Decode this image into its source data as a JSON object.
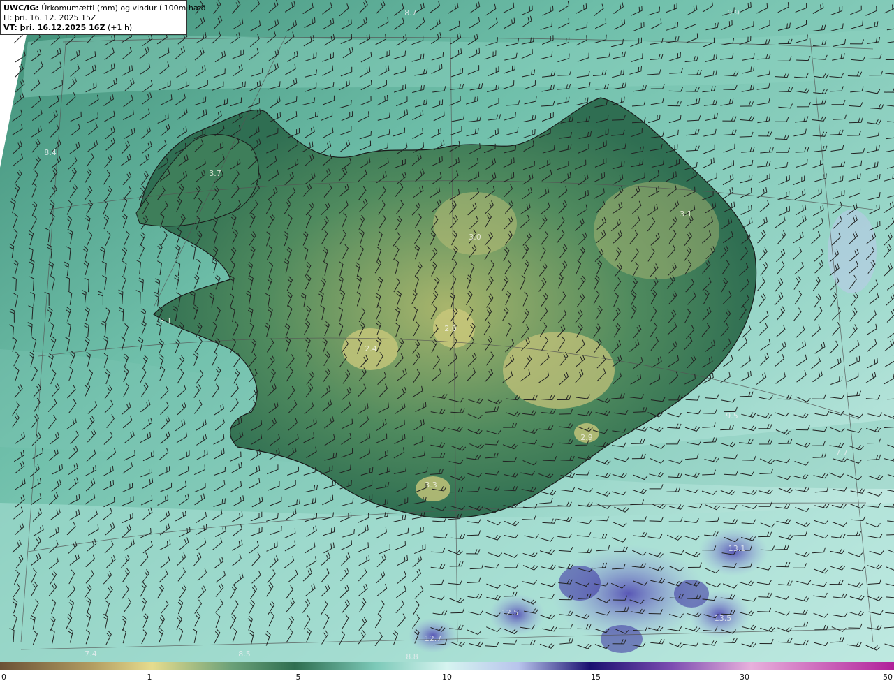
{
  "header": {
    "model_label": "UWC/IG:",
    "description": "Úrkomumætti (mm) og vindur í 100m hæð",
    "issue_time": "IT: þri. 16. 12. 2025 15Z",
    "valid_label": "VT: þri. 16.12.2025 16Z",
    "valid_offset": "(+1 h)"
  },
  "colorbar": {
    "ticks": [
      "0",
      "1",
      "5",
      "10",
      "15",
      "30",
      "50"
    ],
    "stops": [
      "#7a5a3a",
      "#c9b46a",
      "#e8e08c",
      "#2e6e50",
      "#8fd4c4",
      "#d6f4f0",
      "#2a1a7a",
      "#7b4bb0",
      "#e8a8d8",
      "#b0209a"
    ]
  },
  "map_values": [
    {
      "text": "3.7",
      "kind": "land"
    },
    {
      "text": "3.0",
      "kind": "land"
    },
    {
      "text": "3.1",
      "kind": "land"
    },
    {
      "text": "3.1",
      "kind": "land"
    },
    {
      "text": "2.4",
      "kind": "land"
    },
    {
      "text": "2.0",
      "kind": "land"
    },
    {
      "text": "2.9",
      "kind": "land"
    },
    {
      "text": "3.3",
      "kind": "land"
    },
    {
      "text": "8.4",
      "kind": "sea"
    },
    {
      "text": "8.7",
      "kind": "sea"
    },
    {
      "text": "9.9",
      "kind": "sea"
    },
    {
      "text": "9.5",
      "kind": "sea"
    },
    {
      "text": "7.7",
      "kind": "sea"
    },
    {
      "text": "13.1",
      "kind": "sea"
    },
    {
      "text": "12.5",
      "kind": "sea"
    },
    {
      "text": "13.5",
      "kind": "sea"
    },
    {
      "text": "12.7",
      "kind": "sea"
    },
    {
      "text": "7.4",
      "kind": "sea"
    },
    {
      "text": "8.5",
      "kind": "sea"
    },
    {
      "text": "8.8",
      "kind": "sea"
    }
  ],
  "colors": {
    "land_low": "#2f6e52",
    "land_high": "#c8c77a",
    "sea": "#7cc9b8",
    "sea_light": "#cdeee8",
    "heavy": "#5a4fb8",
    "coast": "#1a1a1a",
    "barb": "#222222",
    "grid": "#555555"
  }
}
